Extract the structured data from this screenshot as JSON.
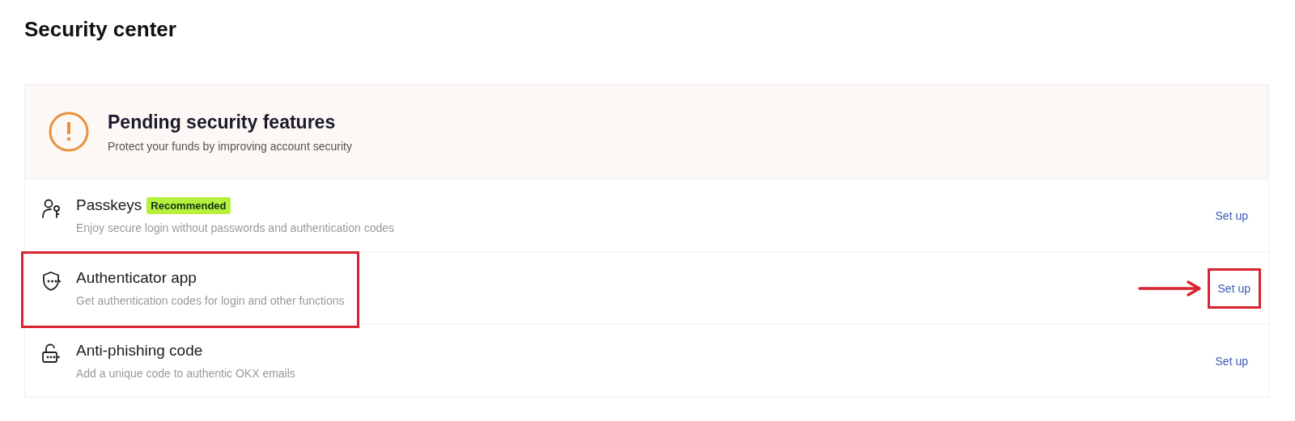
{
  "page_title": "Security center",
  "pending": {
    "title": "Pending security features",
    "subtitle": "Protect your funds by improving account security"
  },
  "features": [
    {
      "kind": "passkey",
      "title": "Passkeys",
      "badge": "Recommended",
      "description": "Enjoy secure login without passwords and authentication codes",
      "action": "Set up",
      "highlighted": false
    },
    {
      "kind": "shield",
      "title": "Authenticator app",
      "description": "Get authentication codes for login and other functions",
      "action": "Set up",
      "highlighted": true
    },
    {
      "kind": "lock",
      "title": "Anti-phishing code",
      "description": "Add a unique code to authentic OKX emails",
      "action": "Set up",
      "highlighted": false
    }
  ]
}
